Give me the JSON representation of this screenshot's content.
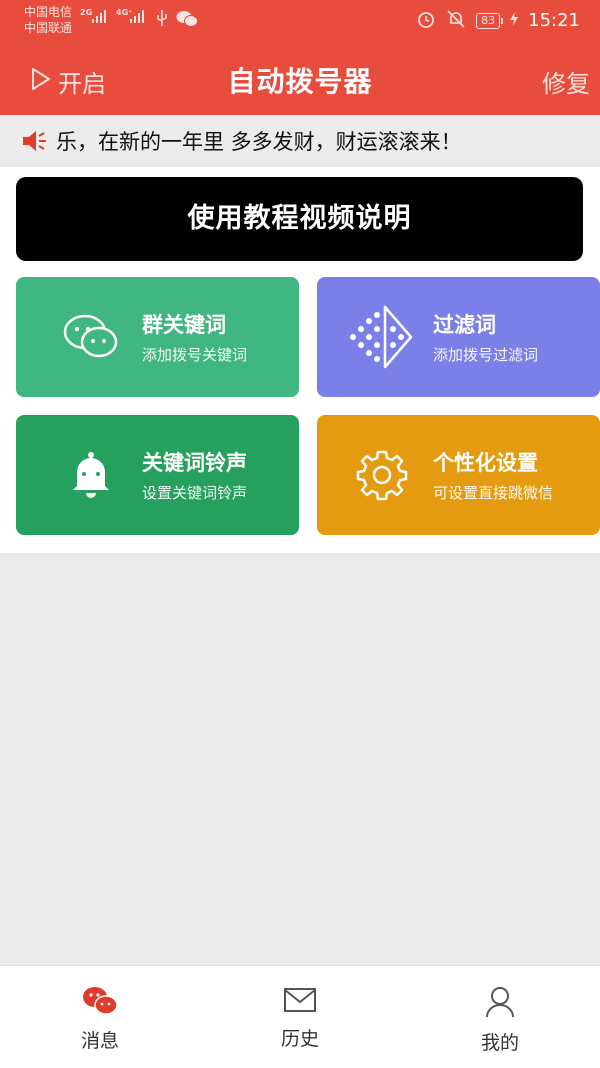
{
  "status_bar": {
    "carrier1": "中国电信",
    "carrier2": "中国联通",
    "net1": "2G",
    "net2": "4G⁺",
    "battery": "83",
    "time": "15:21",
    "icons": [
      "signal-icon",
      "usb-icon",
      "wechat-icon",
      "alarm-icon",
      "mute-bell-icon",
      "battery-icon",
      "charging-icon"
    ]
  },
  "header": {
    "start_label": "开启",
    "title": "自动拨号器",
    "repair_label": "修复",
    "bg_color": "#e74c3c"
  },
  "marquee": {
    "text": "乐，在新的一年里 多多发财，财运滚滚来！"
  },
  "tutorial": {
    "label": "使用教程视频说明"
  },
  "cards": [
    {
      "title": "群关键词",
      "subtitle": "添加拨号关键词",
      "color": "#40b780",
      "icon": "chat-bubbles-icon"
    },
    {
      "title": "过滤词",
      "subtitle": "添加拨号过滤词",
      "color": "#7b7fe8",
      "icon": "filter-dots-icon"
    },
    {
      "title": "关键词铃声",
      "subtitle": "设置关键词铃声",
      "color": "#26a05e",
      "icon": "bell-icon"
    },
    {
      "title": "个性化设置",
      "subtitle": "可设置直接跳微信",
      "color": "#e49b0f",
      "icon": "gear-icon"
    }
  ],
  "tabs": [
    {
      "label": "消息",
      "icon": "messages-icon",
      "active": true
    },
    {
      "label": "历史",
      "icon": "mail-icon",
      "active": false
    },
    {
      "label": "我的",
      "icon": "profile-icon",
      "active": false
    }
  ]
}
